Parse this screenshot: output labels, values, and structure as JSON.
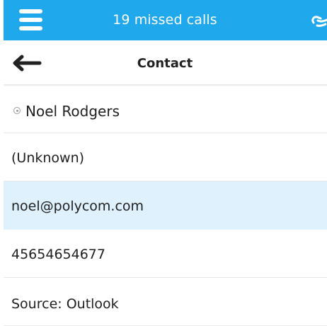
{
  "top_bar": {
    "title": "19 missed calls",
    "menu_icon": "hamburger-menu-icon",
    "link_icon": "link-icon"
  },
  "nav": {
    "title": "Contact",
    "back_icon": "back-arrow-icon"
  },
  "contact": {
    "name": "Noel Rodgers",
    "presence_icon": "presence-status-icon",
    "company": "(Unknown)",
    "email": "noel@polycom.com",
    "phone": "45654654677",
    "source": "Source: Outlook"
  },
  "colors": {
    "top_bar": "#1fa8ec",
    "selected_row": "#dff1fc",
    "text": "#202020"
  }
}
